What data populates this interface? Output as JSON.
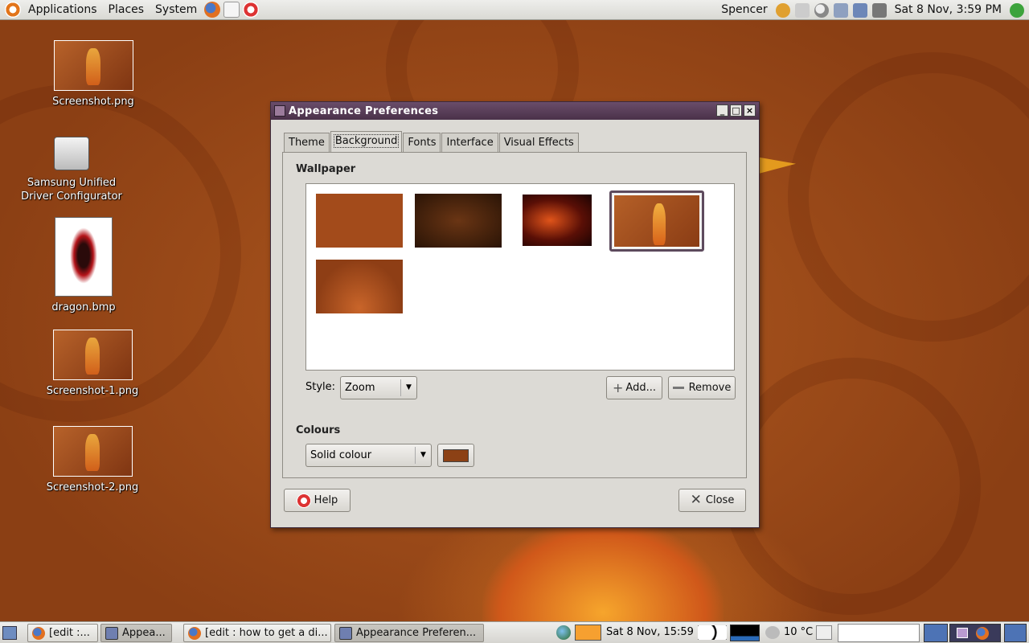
{
  "top_panel": {
    "menus": [
      "Applications",
      "Places",
      "System"
    ],
    "user": "Spencer",
    "clock": "Sat  8 Nov,  3:59 PM"
  },
  "desktop_icons": [
    {
      "label": "Screenshot.png"
    },
    {
      "label": "Samsung Unified Driver Configurator"
    },
    {
      "label": "dragon.bmp"
    },
    {
      "label": "Screenshot-1.png"
    },
    {
      "label": "Screenshot-2.png"
    }
  ],
  "window": {
    "title": "Appearance Preferences",
    "tabs": [
      "Theme",
      "Background",
      "Fonts",
      "Interface",
      "Visual Effects"
    ],
    "active_tab": "Background",
    "wallpaper_label": "Wallpaper",
    "style_label": "Style:",
    "style_value": "Zoom",
    "add_label": "Add...",
    "remove_label": "Remove",
    "colours_label": "Colours",
    "colour_mode": "Solid colour",
    "colour_value": "#8c4115",
    "help_label": "Help",
    "close_label": "Close"
  },
  "taskbar": {
    "tasks": [
      "[edit :...",
      "Appea...",
      "[edit : how to get a di...",
      "Appearance Preferen..."
    ],
    "clock": "Sat  8 Nov, 15:59",
    "temperature": "10 °C"
  },
  "colors": {
    "desktop": "#a3501d",
    "titlebar": "#5a3d5a",
    "dialog_bg": "#dcdad5"
  }
}
